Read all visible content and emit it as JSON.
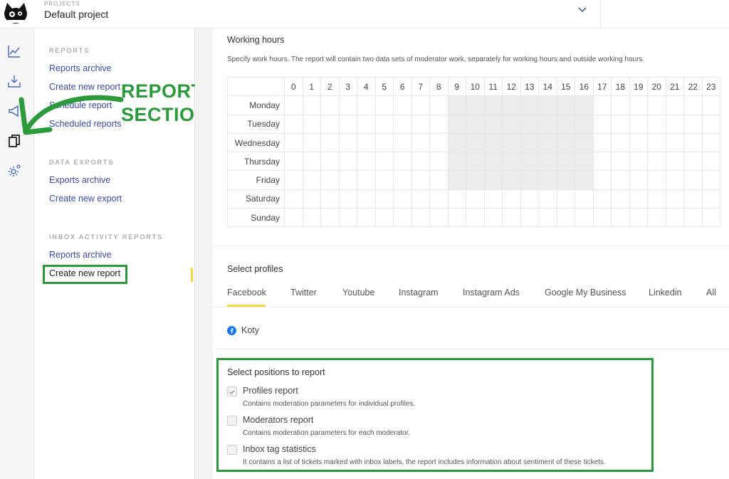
{
  "header": {
    "projects_label": "PROJECTS",
    "project_name": "Default project"
  },
  "rail": {
    "icons": [
      "line-chart-icon",
      "download-icon",
      "megaphone-icon",
      "copy-icon",
      "settings-gear-icon"
    ]
  },
  "sidebar": {
    "reports": {
      "title": "REPORTS",
      "links": [
        "Reports archive",
        "Create new report",
        "Schedule report",
        "Scheduled reports"
      ]
    },
    "data_exports": {
      "title": "DATA EXPORTS",
      "links": [
        "Exports archive",
        "Create new export"
      ]
    },
    "inbox_activity": {
      "title": "INBOX ACTIVITY REPORTS",
      "links": [
        "Reports archive",
        "Create new report"
      ]
    }
  },
  "annotation": {
    "line1": "REPORTS",
    "line2": "SECTION",
    "color": "#2a9a3a"
  },
  "working_hours": {
    "title": "Working hours",
    "description": "Specify work hours. The report will contain two data sets of moderator work, separately for working hours and outside working hours.",
    "hours": [
      "0",
      "1",
      "2",
      "3",
      "4",
      "5",
      "6",
      "7",
      "8",
      "9",
      "10",
      "11",
      "12",
      "13",
      "14",
      "15",
      "16",
      "17",
      "18",
      "19",
      "20",
      "21",
      "22",
      "23"
    ],
    "days": [
      "Monday",
      "Tuesday",
      "Wednesday",
      "Thursday",
      "Friday",
      "Saturday",
      "Sunday"
    ],
    "selected_days": [
      "Monday",
      "Tuesday",
      "Wednesday",
      "Thursday",
      "Friday"
    ],
    "selected_hours_from": 9,
    "selected_hours_to": 17
  },
  "profiles": {
    "title": "Select profiles",
    "tabs": [
      "Facebook",
      "Twitter",
      "Youtube",
      "Instagram",
      "Instagram Ads",
      "Google My Business",
      "Linkedin",
      "All"
    ],
    "active_tab": "Facebook",
    "items": [
      "Koty"
    ]
  },
  "positions": {
    "title": "Select positions to report",
    "options": [
      {
        "label": "Profiles report",
        "desc": "Contains moderation parameters for individual profiles.",
        "checked": true
      },
      {
        "label": "Moderators report",
        "desc": "Contains moderation parameters for each moderator.",
        "checked": false
      },
      {
        "label": "Inbox tag statistics",
        "desc": "It contains a list of tickets marked with inbox labels, the report includes information about sentiment of these tickets.",
        "checked": false
      }
    ]
  },
  "colors": {
    "accent_link": "#3b4aa8",
    "highlight_green": "#2a9a3a",
    "active_yellow": "#f5d53a",
    "facebook_blue": "#1877f2"
  }
}
